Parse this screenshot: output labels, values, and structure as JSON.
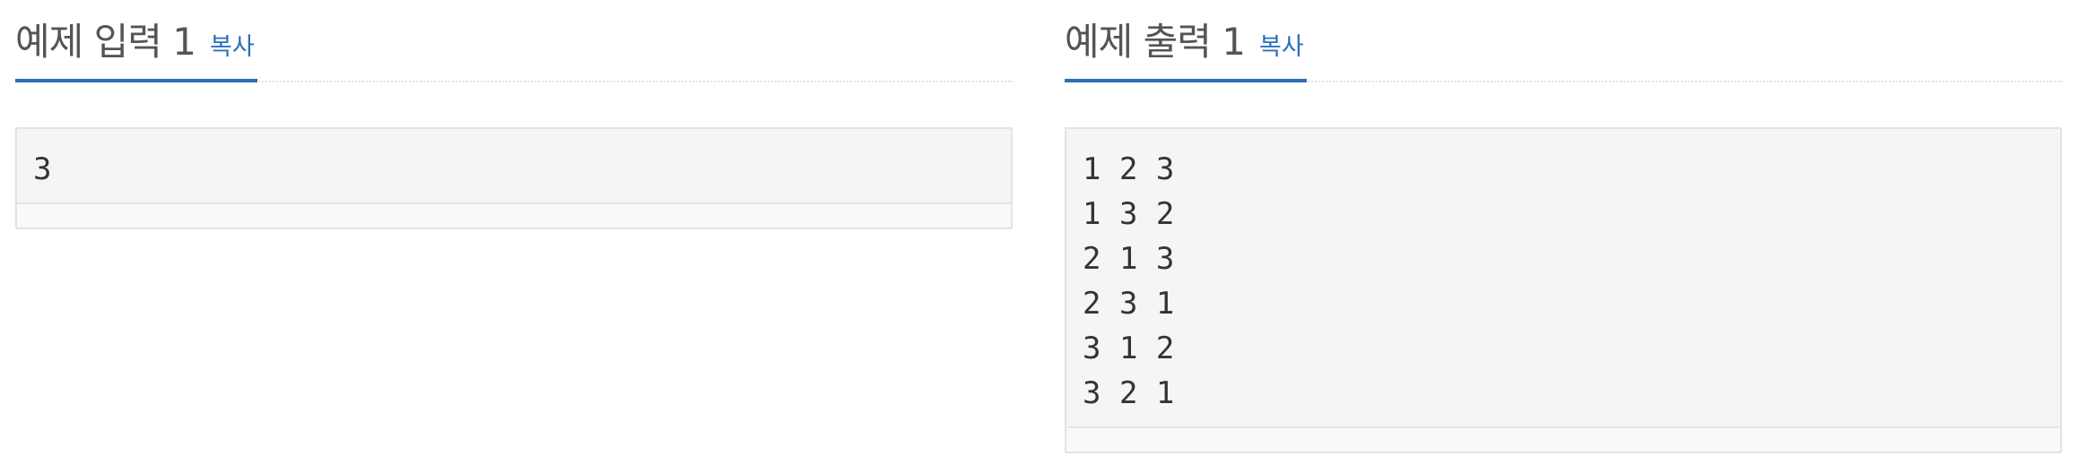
{
  "input_panel": {
    "title": "예제 입력 1",
    "copy_label": "복사",
    "content": "3"
  },
  "output_panel": {
    "title": "예제 출력 1",
    "copy_label": "복사",
    "content": "1 2 3\n1 3 2\n2 1 3\n2 3 1\n3 1 2\n3 2 1"
  },
  "colors": {
    "accent": "#2c6fb3",
    "link": "#2a6fbd",
    "box_background": "#f5f5f6",
    "title_text": "#555555"
  }
}
